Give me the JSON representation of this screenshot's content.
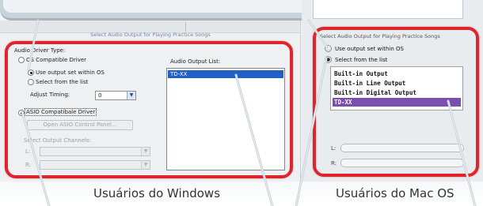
{
  "windows": {
    "section_title": "Select Audio Output for Playing Practice Songs",
    "audio_driver_type_label": "Audio Driver Type:",
    "os_compatible_driver": "OS Compatible Driver",
    "use_output_set_within_os": "Use output set within OS",
    "select_from_list": "Select from the list",
    "adjust_timing_label": "Adjust Timing:",
    "adjust_timing_value": "0",
    "asio_driver": "ASIO Compatibale Driver",
    "open_asio_button": "Open ASIO Control Panel...",
    "select_output_channels_label": "Select Output Channels:",
    "left_label": "L:",
    "right_label": "R:",
    "audio_output_list_label": "Audio Output List:",
    "audio_output_list": [
      "TD-XX"
    ]
  },
  "mac": {
    "section_title": "Select Audio Output for Playing Practice Songs",
    "use_output_set_within_os": "Use output set within OS",
    "select_from_list": "Select from the list",
    "output_list": [
      "Built-in Output",
      "Built-in Line Output",
      "Built-in Digital Output",
      "TD-XX"
    ],
    "selected_output": "TD-XX",
    "left_label": "L:",
    "right_label": "R:"
  },
  "captions": {
    "windows_users": "Usuários do Windows",
    "mac_users": "Usuários do Mac OS"
  },
  "colors": {
    "highlight_frame": "#e0242b",
    "windows_selection": "#1f5fc8",
    "mac_selection": "#7a4fb0",
    "callout": "#c9d3da"
  }
}
